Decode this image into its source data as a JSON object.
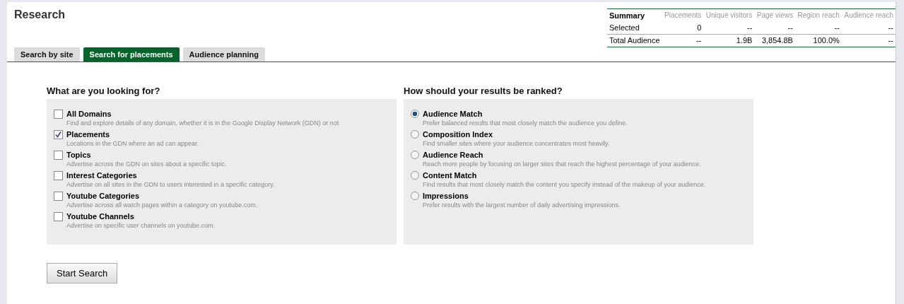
{
  "title": "Research",
  "summary": {
    "columns": [
      "Summary",
      "Placements",
      "Unique visitors",
      "Page views",
      "Region reach",
      "Audience reach"
    ],
    "rows": [
      [
        "Selected",
        "0",
        "--",
        "--",
        "--",
        "--"
      ],
      [
        "Total Audience",
        "--",
        "1.9B",
        "3,854.8B",
        "100.0%",
        "--"
      ]
    ]
  },
  "tabs": [
    {
      "label": "Search by site",
      "selected": false
    },
    {
      "label": "Search for placements",
      "selected": true
    },
    {
      "label": "Audience planning",
      "selected": false
    }
  ],
  "looking_for": {
    "heading": "What are you looking for?",
    "options": [
      {
        "label": "All Domains",
        "description": "Find and explore details of any domain, whether it is in the Google Display Network (GDN) or not",
        "checked": false
      },
      {
        "label": "Placements",
        "description": "Locations in the GDN where an ad can appear.",
        "checked": true
      },
      {
        "label": "Topics",
        "description": "Advertise across the GDN on sites about a specific topic.",
        "checked": false
      },
      {
        "label": "Interest Categories",
        "description": "Advertise on all sites in the GDN to users interested in a specific category.",
        "checked": false
      },
      {
        "label": "Youtube Categories",
        "description": "Advertise across all watch pages within a category on youtube.com.",
        "checked": false
      },
      {
        "label": "Youtube Channels",
        "description": "Advertise on specific user channels on youtube.com.",
        "checked": false
      }
    ]
  },
  "ranking": {
    "heading": "How should your results be ranked?",
    "options": [
      {
        "label": "Audience Match",
        "description": "Prefer balanced results that most closely match the audience you define.",
        "selected": true
      },
      {
        "label": "Composition Index",
        "description": "Find smaller sites where your audience concentrates most heavily.",
        "selected": false
      },
      {
        "label": "Audience Reach",
        "description": "Reach more people by focusing on larger sites that reach the highest percentage of your audience.",
        "selected": false
      },
      {
        "label": "Content Match",
        "description": "Find results that most closely match the content you specify instead of the makeup of your audience.",
        "selected": false
      },
      {
        "label": "Impressions",
        "description": "Prefer results with the largest number of daily advertising impressions.",
        "selected": false
      }
    ]
  },
  "start_button": "Start Search"
}
